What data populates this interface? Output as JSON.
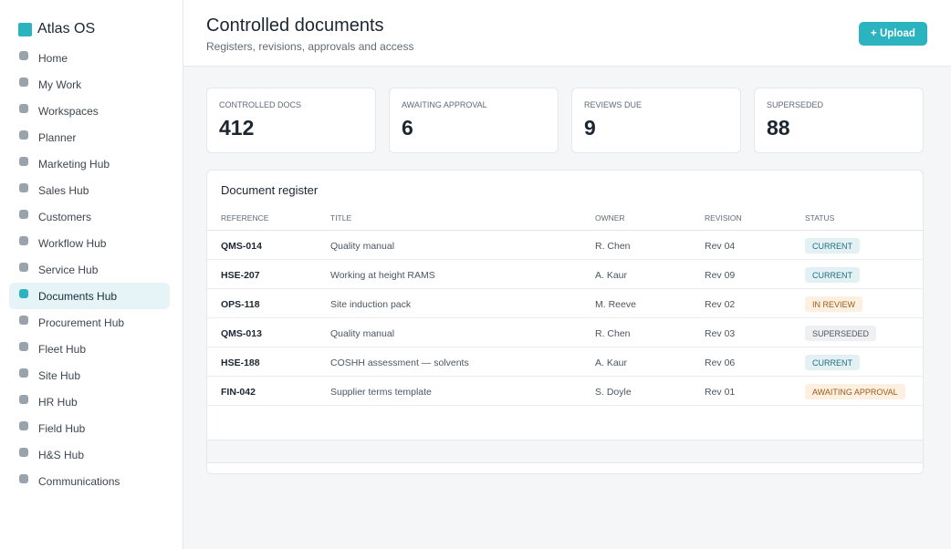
{
  "app": {
    "name": "Atlas OS",
    "accent": "#2bb3c0"
  },
  "sidebar": {
    "items": [
      {
        "label": "Home"
      },
      {
        "label": "My Work"
      },
      {
        "label": "Workspaces"
      },
      {
        "label": "Planner"
      },
      {
        "label": "Marketing Hub"
      },
      {
        "label": "Sales Hub"
      },
      {
        "label": "Customers"
      },
      {
        "label": "Workflow Hub"
      },
      {
        "label": "Service Hub"
      },
      {
        "label": "Documents Hub",
        "active": true
      },
      {
        "label": "Procurement Hub"
      },
      {
        "label": "Fleet Hub"
      },
      {
        "label": "Site Hub"
      },
      {
        "label": "HR Hub"
      },
      {
        "label": "Field Hub"
      },
      {
        "label": "H&S Hub"
      },
      {
        "label": "Communications"
      }
    ]
  },
  "header": {
    "title": "Controlled documents",
    "subtitle": "Registers, revisions, approvals and access",
    "upload_label": "+ Upload"
  },
  "stats": [
    {
      "label": "CONTROLLED DOCS",
      "value": "412"
    },
    {
      "label": "AWAITING APPROVAL",
      "value": "6"
    },
    {
      "label": "REVIEWS DUE",
      "value": "9"
    },
    {
      "label": "SUPERSEDED",
      "value": "88"
    }
  ],
  "register": {
    "title": "Document register",
    "columns": [
      "REFERENCE",
      "TITLE",
      "OWNER",
      "REVISION",
      "STATUS"
    ],
    "rows": [
      {
        "reference": "QMS-014",
        "title": "Quality manual",
        "owner": "R. Chen",
        "revision": "Rev 04",
        "status": "CURRENT",
        "status_kind": "current"
      },
      {
        "reference": "HSE-207",
        "title": "Working at height RAMS",
        "owner": "A. Kaur",
        "revision": "Rev 09",
        "status": "CURRENT",
        "status_kind": "current"
      },
      {
        "reference": "OPS-118",
        "title": "Site induction pack",
        "owner": "M. Reeve",
        "revision": "Rev 02",
        "status": "IN REVIEW",
        "status_kind": "review"
      },
      {
        "reference": "QMS-013",
        "title": "Quality manual",
        "owner": "R. Chen",
        "revision": "Rev 03",
        "status": "SUPERSEDED",
        "status_kind": "superseded"
      },
      {
        "reference": "HSE-188",
        "title": "COSHH assessment — solvents",
        "owner": "A. Kaur",
        "revision": "Rev 06",
        "status": "CURRENT",
        "status_kind": "current"
      },
      {
        "reference": "FIN-042",
        "title": "Supplier terms template",
        "owner": "S. Doyle",
        "revision": "Rev 01",
        "status": "AWAITING APPROVAL",
        "status_kind": "approval"
      }
    ]
  }
}
